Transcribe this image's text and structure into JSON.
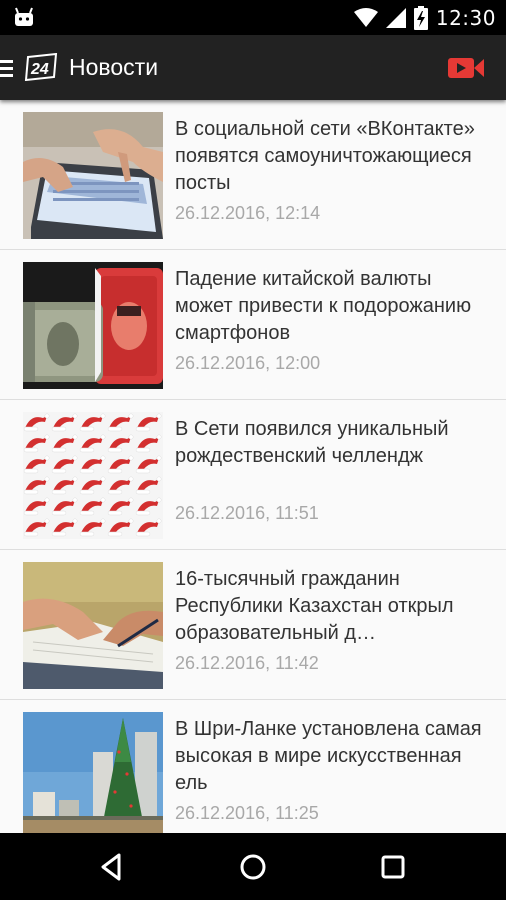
{
  "status_bar": {
    "time": "12:30",
    "icons": [
      "android-icon",
      "wifi-icon",
      "signal-icon",
      "battery-charging-icon"
    ]
  },
  "app_bar": {
    "title": "Новости",
    "logo_text": "24",
    "icons": [
      "menu-icon",
      "channel-24-logo",
      "video-camera-icon"
    ],
    "accent_color": "#e53935"
  },
  "news": [
    {
      "title": "В социальной сети «ВКонтакте» появятся самоуничтожающиеся посты",
      "date": "26.12.2016, 12:14",
      "image": "hands-on-tablet"
    },
    {
      "title": "Падение китайской валюты может привести к подорожанию смартфонов",
      "date": "26.12.2016, 12:00",
      "image": "dollar-and-yuan-banknotes"
    },
    {
      "title": "В Сети появился уникальный рождественский челлендж",
      "date": "26.12.2016, 11:51",
      "image": "santa-hats-pattern"
    },
    {
      "title": "16-тысячный гражданин Республики Казахстан открыл образовательный д…",
      "date": "26.12.2016, 11:42",
      "image": "hands-writing-notebook"
    },
    {
      "title": "В Шри-Ланке установлена самая высокая в мире искусственная ель",
      "date": "26.12.2016, 11:25",
      "image": "giant-christmas-tree-city"
    }
  ],
  "nav_bar": {
    "icons": [
      "back-icon",
      "home-icon",
      "recents-icon"
    ]
  }
}
